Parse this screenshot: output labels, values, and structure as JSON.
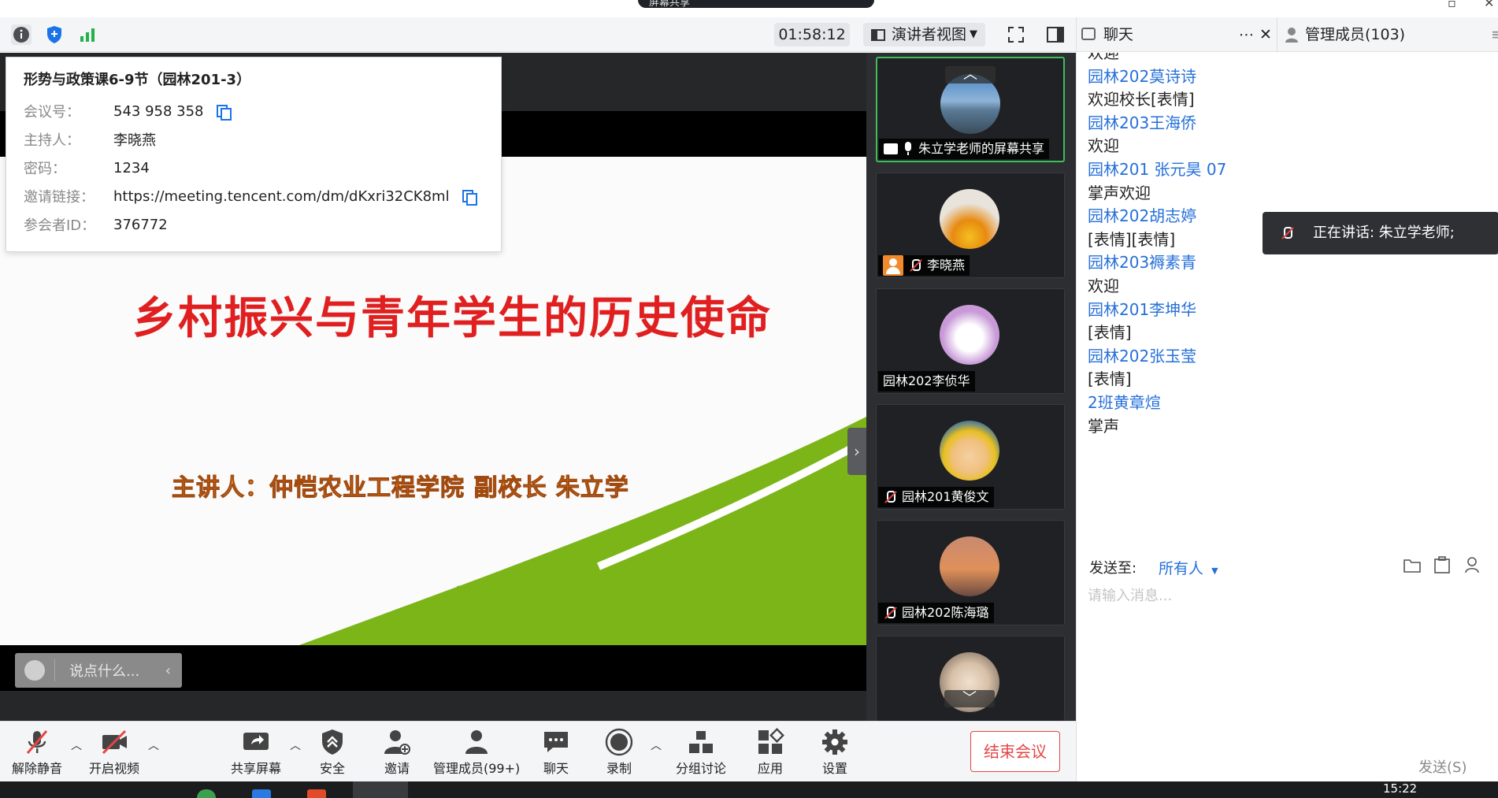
{
  "window": {
    "title": "屏幕共享"
  },
  "topbar": {
    "timer": "01:58:12",
    "view_label": "演讲者视图"
  },
  "info": {
    "title": "形势与政策课6-9节（园林201-3）",
    "rows": [
      {
        "key": "会议号：",
        "value": "543 958 358"
      },
      {
        "key": "主持人：",
        "value": "李晓燕"
      },
      {
        "key": "密码：",
        "value": "1234"
      },
      {
        "key": "邀请链接：",
        "value": "https://meeting.tencent.com/dm/dKxri32CK8ml"
      },
      {
        "key": "参会者ID：",
        "value": "376772"
      }
    ]
  },
  "slide": {
    "title": "乡村振兴与青年学生的历史使命",
    "subtitle": "主讲人：仲恺农业工程学院 副校长 朱立学"
  },
  "saybar": {
    "placeholder": "说点什么..."
  },
  "participants": [
    {
      "name": "朱立学老师的屏幕共享",
      "sharing": true
    },
    {
      "name": "李晓燕",
      "muted": true,
      "host": true
    },
    {
      "name": "园林202李侦华"
    },
    {
      "name": "园林201黄俊文",
      "muted": true
    },
    {
      "name": "园林202陈海璐",
      "muted": true
    },
    {
      "name": ""
    }
  ],
  "rpanel": {
    "tab_chat": "聊天",
    "tab_members": "管理成员(103)",
    "messages": [
      {
        "type": "body",
        "text": "欢迎"
      },
      {
        "type": "sender",
        "text": "园林202莫诗诗"
      },
      {
        "type": "body",
        "text": "欢迎校长[表情]"
      },
      {
        "type": "sender",
        "text": "园林203王海侨"
      },
      {
        "type": "body",
        "text": "欢迎"
      },
      {
        "type": "sender",
        "text": "园林201 张元昊 07"
      },
      {
        "type": "body",
        "text": "掌声欢迎"
      },
      {
        "type": "sender",
        "text": "园林202胡志婷"
      },
      {
        "type": "body",
        "text": "[表情][表情]"
      },
      {
        "type": "sender",
        "text": "园林203褥素青"
      },
      {
        "type": "body",
        "text": "欢迎"
      },
      {
        "type": "sender",
        "text": "园林201李坤华"
      },
      {
        "type": "body",
        "text": "[表情]"
      },
      {
        "type": "sender",
        "text": "园林202张玉莹"
      },
      {
        "type": "body",
        "text": "[表情]"
      },
      {
        "type": "sender",
        "text": "2班黄章煊"
      },
      {
        "type": "body",
        "text": "掌声"
      }
    ],
    "speaking": "正在讲话: 朱立学老师;",
    "send_to_label": "发送至:",
    "send_to_value": "所有人",
    "input_placeholder": "请输入消息...",
    "send_button": "发送(S)"
  },
  "toolbar": {
    "unmute": "解除静音",
    "video": "开启视频",
    "share": "共享屏幕",
    "security": "安全",
    "invite": "邀请",
    "members": "管理成员(99+)",
    "chat": "聊天",
    "record": "录制",
    "breakout": "分组讨论",
    "apps": "应用",
    "settings": "设置",
    "end": "结束会议"
  },
  "taskbar": {
    "clock": "15:22"
  },
  "colors": {
    "accent": "#2670d9",
    "end": "#e54545",
    "active_tile": "#3dbd5c",
    "slide_title": "#e02020",
    "slide_green": "#7cb518"
  }
}
